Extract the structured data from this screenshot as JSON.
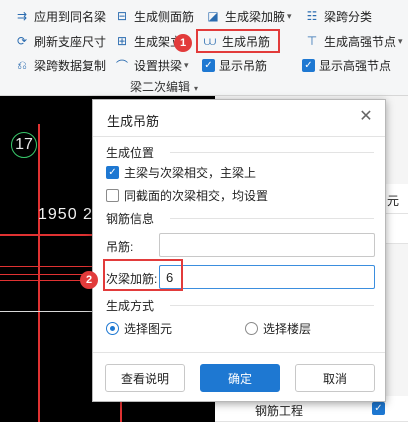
{
  "ribbon": {
    "row1": [
      {
        "label": "应用到同名梁",
        "icon": "apply-same-name-icon"
      },
      {
        "label": "生成侧面筋",
        "icon": "side-rebar-icon"
      },
      {
        "label": "生成梁加腋",
        "icon": "beam-haunch-icon",
        "has_dropdown": true
      },
      {
        "label": "梁跨分类",
        "icon": "span-classify-icon"
      }
    ],
    "row2": [
      {
        "label": "刷新支座尺寸",
        "icon": "refresh-support-icon"
      },
      {
        "label": "生成架立",
        "icon": "erect-rebar-icon"
      },
      {
        "label": "生成吊筋",
        "icon": "hanger-rebar-icon"
      },
      {
        "label": "生成高强节点",
        "icon": "high-strength-node-icon",
        "has_dropdown": true
      }
    ],
    "row3": [
      {
        "label": "梁跨数据复制",
        "icon": "span-copy-icon"
      },
      {
        "label": "设置拱梁",
        "icon": "arch-beam-icon",
        "has_dropdown": true
      },
      {
        "label": "显示吊筋",
        "checked": true
      },
      {
        "label": "显示高强节点",
        "checked": true
      }
    ],
    "group_label": "梁二次编辑"
  },
  "annotations": {
    "marker1": "1",
    "marker2": "2"
  },
  "canvas": {
    "axis_label": "17",
    "dimension_text": "1950 2"
  },
  "right_panel": {
    "partial_label": "元",
    "bottom_row_label": "钢筋工程",
    "bottom_row_checked": true
  },
  "dialog": {
    "title": "生成吊筋",
    "section_position": "生成位置",
    "option_main_secondary": "主梁与次梁相交，主梁上",
    "option_main_secondary_checked": true,
    "option_same_section": "同截面的次梁相交，均设置",
    "option_same_section_checked": false,
    "section_rebar_info": "钢筋信息",
    "hanger_label": "吊筋:",
    "hanger_value": "",
    "secondary_label": "次梁加筋:",
    "secondary_value": "6",
    "section_method": "生成方式",
    "radio_select_element": "选择图元",
    "radio_select_element_selected": true,
    "radio_select_floor": "选择楼层",
    "radio_select_floor_selected": false,
    "btn_help": "查看说明",
    "btn_ok": "确定",
    "btn_cancel": "取消"
  },
  "colors": {
    "accent": "#1e78d2",
    "highlight": "#e23b3b",
    "axis_line": "#e03232",
    "axis_bubble": "#38c76a"
  }
}
